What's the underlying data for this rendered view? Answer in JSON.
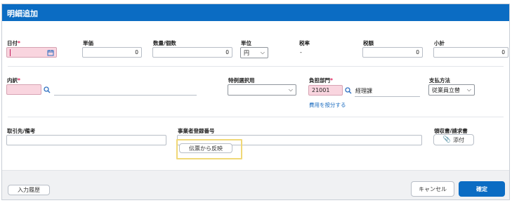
{
  "dialog": {
    "title": "明細追加"
  },
  "row1": {
    "date_label": "日付",
    "unit_price_label": "単価",
    "unit_price_value": "0",
    "quantity_label": "数量/個数",
    "quantity_value": "0",
    "unit_label": "単位",
    "unit_value": "円",
    "tax_rate_label": "税率",
    "tax_rate_value": "-",
    "tax_amount_label": "税額",
    "tax_amount_value": "0",
    "subtotal_label": "小計",
    "subtotal_value": "0"
  },
  "row2": {
    "breakdown_label": "内訳",
    "special_label": "特例選択用",
    "dept_label": "負担部門",
    "dept_code": "21001",
    "dept_name": "経理課",
    "split_link": "費用を按分する",
    "payment_label": "支払方法",
    "payment_value": "従業員立替"
  },
  "row3": {
    "vendor_label": "取引先/備考",
    "registration_label": "事業者登録番号",
    "reflect_button": "伝票から反映",
    "receipt_label": "領収書/請求書",
    "attach_button": "添付"
  },
  "footer": {
    "history_button": "入力履歴",
    "cancel_button": "キャンセル",
    "confirm_button": "確定"
  },
  "required_mark": "*"
}
